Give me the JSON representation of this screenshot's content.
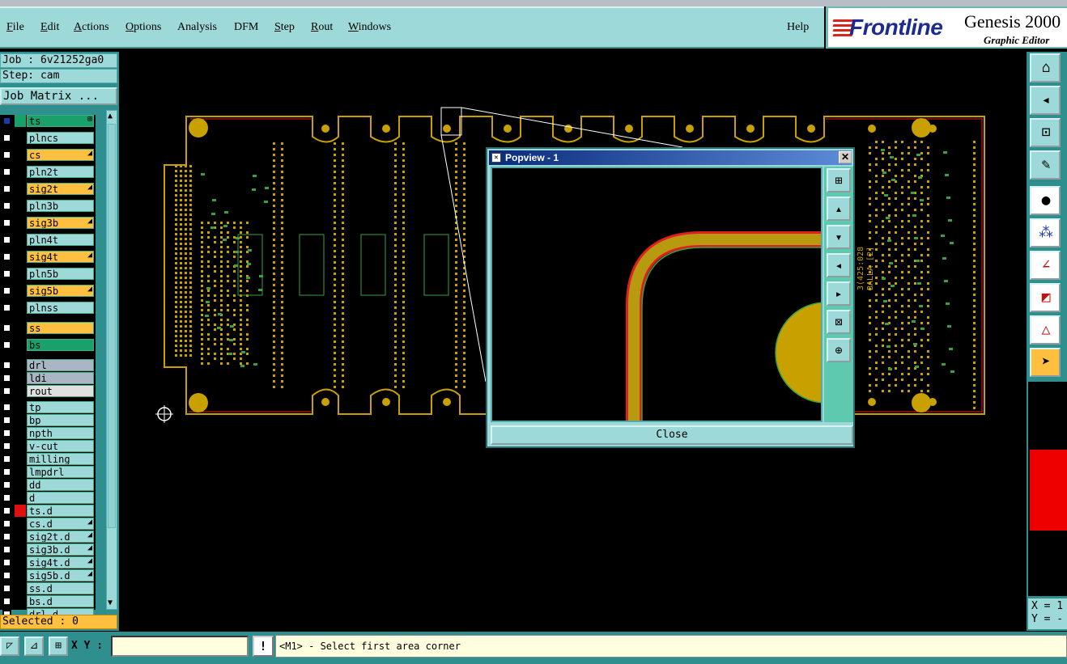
{
  "menubar": {
    "items": [
      "File",
      "Edit",
      "Actions",
      "Options",
      "Analysis",
      "DFM",
      "Step",
      "Rout",
      "Windows"
    ],
    "help": "Help"
  },
  "brand": {
    "logo": "Frontline",
    "product": "Genesis 2000",
    "subtitle": "Graphic Editor"
  },
  "left_panel": {
    "job": "Job : 6v21252ga0",
    "step": "Step: cam",
    "job_matrix": "Job Matrix ...",
    "selected": "Selected : 0",
    "layers": [
      {
        "name": "ts",
        "color": "#1aa06a",
        "swatch": "#1aa06a",
        "checked": true,
        "mark": "⊞"
      },
      {
        "name": "plncs",
        "color": "#9ed9d9"
      },
      {
        "name": "cs",
        "color": "#ffbf3f",
        "mark": "◢"
      },
      {
        "name": "pln2t",
        "color": "#9ed9d9"
      },
      {
        "name": "sig2t",
        "color": "#ffbf3f",
        "mark": "◢"
      },
      {
        "name": "pln3b",
        "color": "#9ed9d9"
      },
      {
        "name": "sig3b",
        "color": "#ffbf3f",
        "mark": "◢"
      },
      {
        "name": "pln4t",
        "color": "#9ed9d9"
      },
      {
        "name": "sig4t",
        "color": "#ffbf3f",
        "mark": "◢"
      },
      {
        "name": "pln5b",
        "color": "#9ed9d9"
      },
      {
        "name": "sig5b",
        "color": "#ffbf3f",
        "mark": "◢"
      },
      {
        "name": "plnss",
        "color": "#9ed9d9"
      },
      {
        "name": "ss",
        "color": "#ffbf3f"
      },
      {
        "name": "bs",
        "color": "#1aa06a"
      },
      {
        "name": "drl",
        "color": "#aab6c4"
      },
      {
        "name": "ldi",
        "color": "#aab6c4"
      },
      {
        "name": "rout",
        "color": "#e0e0e0"
      },
      {
        "name": "tp",
        "color": "#9ed9d9"
      },
      {
        "name": "bp",
        "color": "#9ed9d9"
      },
      {
        "name": "npth",
        "color": "#9ed9d9"
      },
      {
        "name": "v-cut",
        "color": "#9ed9d9"
      },
      {
        "name": "milling",
        "color": "#9ed9d9"
      },
      {
        "name": "lmpdrl",
        "color": "#9ed9d9"
      },
      {
        "name": "dd",
        "color": "#9ed9d9"
      },
      {
        "name": "d",
        "color": "#9ed9d9"
      },
      {
        "name": "ts.d",
        "color": "#9ed9d9",
        "swatch": "#e01010"
      },
      {
        "name": "cs.d",
        "color": "#9ed9d9",
        "mark": "◢"
      },
      {
        "name": "sig2t.d",
        "color": "#9ed9d9",
        "mark": "◢"
      },
      {
        "name": "sig3b.d",
        "color": "#9ed9d9",
        "mark": "◢"
      },
      {
        "name": "sig4t.d",
        "color": "#9ed9d9",
        "mark": "◢"
      },
      {
        "name": "sig5b.d",
        "color": "#9ed9d9",
        "mark": "◢"
      },
      {
        "name": "ss.d",
        "color": "#9ed9d9"
      },
      {
        "name": "bs.d",
        "color": "#9ed9d9"
      },
      {
        "name": "drl.d",
        "color": "#9ed9d9"
      }
    ]
  },
  "popview": {
    "title": "Popview - 1",
    "close_label": "Close"
  },
  "board": {
    "silkscreen_text": [
      "3⟨425:028",
      "BALLA [2]"
    ]
  },
  "right_panel": {
    "coord_x": "X = 1",
    "coord_y": "Y = -"
  },
  "statusbar": {
    "xy_label": "X Y :",
    "xy_value": "",
    "prompt": "<M1> - Select first area corner"
  },
  "colors": {
    "panel": "#9ed9d9",
    "accent_orange": "#ffbf3f",
    "copper": "#c8a000",
    "trace_red": "#e02020",
    "outline_green": "#3aa040"
  }
}
